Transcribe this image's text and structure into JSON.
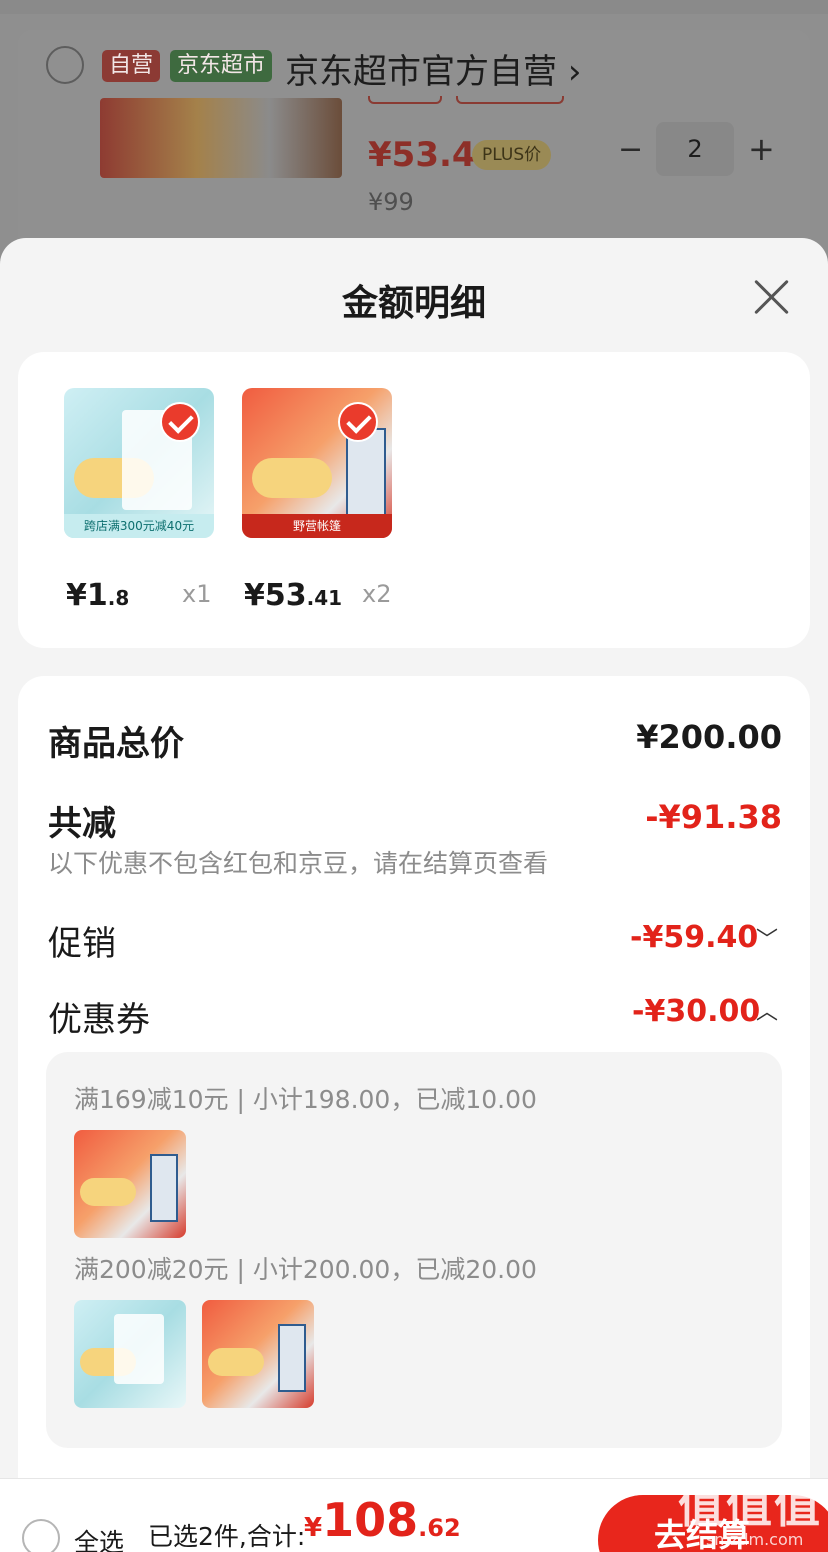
{
  "background": {
    "shop_tag_self": "自营",
    "shop_tag_market": "京东超市",
    "shop_name": "京东超市官方自营",
    "shop_chevron": "›",
    "item_price": "¥53.41",
    "item_plus_label": "PLUS价",
    "item_original_price": "¥99",
    "qty_minus": "−",
    "qty_value": "2",
    "qty_plus": "+"
  },
  "sheet": {
    "title": "金额明细",
    "goods": [
      {
        "price_main": "¥1",
        "price_decimal": ".8",
        "qty": "x1",
        "banner": "跨店满300元减40元"
      },
      {
        "price_main": "¥53",
        "price_decimal": ".41",
        "qty": "x2",
        "banner": "野营帐篷"
      }
    ],
    "total_label": "商品总价",
    "total_value": "¥200.00",
    "discount_label": "共减",
    "discount_value": "-¥91.38",
    "discount_note": "以下优惠不包含红包和京豆，请在结算页查看",
    "promo_label": "促销",
    "promo_value": "-¥59.40",
    "coupon_label": "优惠券",
    "coupon_value": "-¥30.00",
    "coupons": [
      {
        "text": "满169减10元 | 小计198.00，已减10.00"
      },
      {
        "text": "满200减20元 | 小计200.00，已减20.00"
      }
    ]
  },
  "bottom_bar": {
    "select_all": "全选",
    "summary": "已选2件,合计:",
    "currency": "¥",
    "total_main": "108",
    "total_decimal": ".62",
    "checkout": "去结算"
  },
  "watermark": {
    "logo": "值值值",
    "url": "smzdm.com"
  },
  "colors": {
    "accent_red": "#e2231a",
    "checkout_red": "#e8261c",
    "muted_text": "#8c8c8c"
  }
}
